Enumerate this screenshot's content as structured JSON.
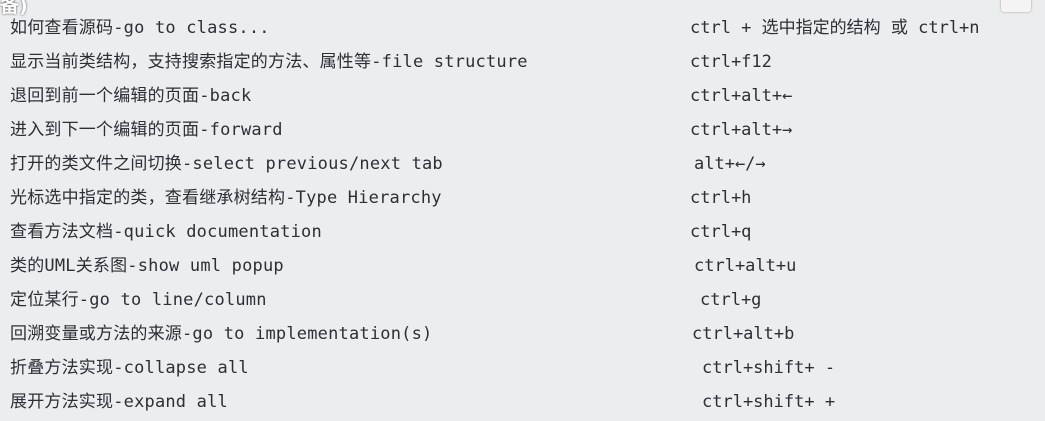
{
  "overlay": {
    "corner_text": "备)"
  },
  "shortcuts": [
    {
      "description": "如何查看源码-go to class...",
      "keys": "ctrl + 选中指定的结构 或 ctrl+n"
    },
    {
      "description": "显示当前类结构，支持搜索指定的方法、属性等-file structure",
      "keys": "ctrl+f12"
    },
    {
      "description": "退回到前一个编辑的页面-back",
      "keys": "ctrl+alt+←"
    },
    {
      "description": "进入到下一个编辑的页面-forward",
      "keys": "ctrl+alt+→"
    },
    {
      "description": "打开的类文件之间切换-select previous/next tab",
      "keys": "alt+←/→"
    },
    {
      "description": "光标选中指定的类，查看继承树结构-Type Hierarchy",
      "keys": "ctrl+h"
    },
    {
      "description": "查看方法文档-quick documentation",
      "keys": "ctrl+q"
    },
    {
      "description": "类的UML关系图-show uml popup",
      "keys": "ctrl+alt+u"
    },
    {
      "description": "定位某行-go to line/column",
      "keys": "ctrl+g"
    },
    {
      "description": "回溯变量或方法的来源-go to implementation(s)",
      "keys": "ctrl+alt+b"
    },
    {
      "description": "折叠方法实现-collapse all",
      "keys": "ctrl+shift+ -"
    },
    {
      "description": "展开方法实现-expand all",
      "keys": "ctrl+shift+ +"
    }
  ]
}
